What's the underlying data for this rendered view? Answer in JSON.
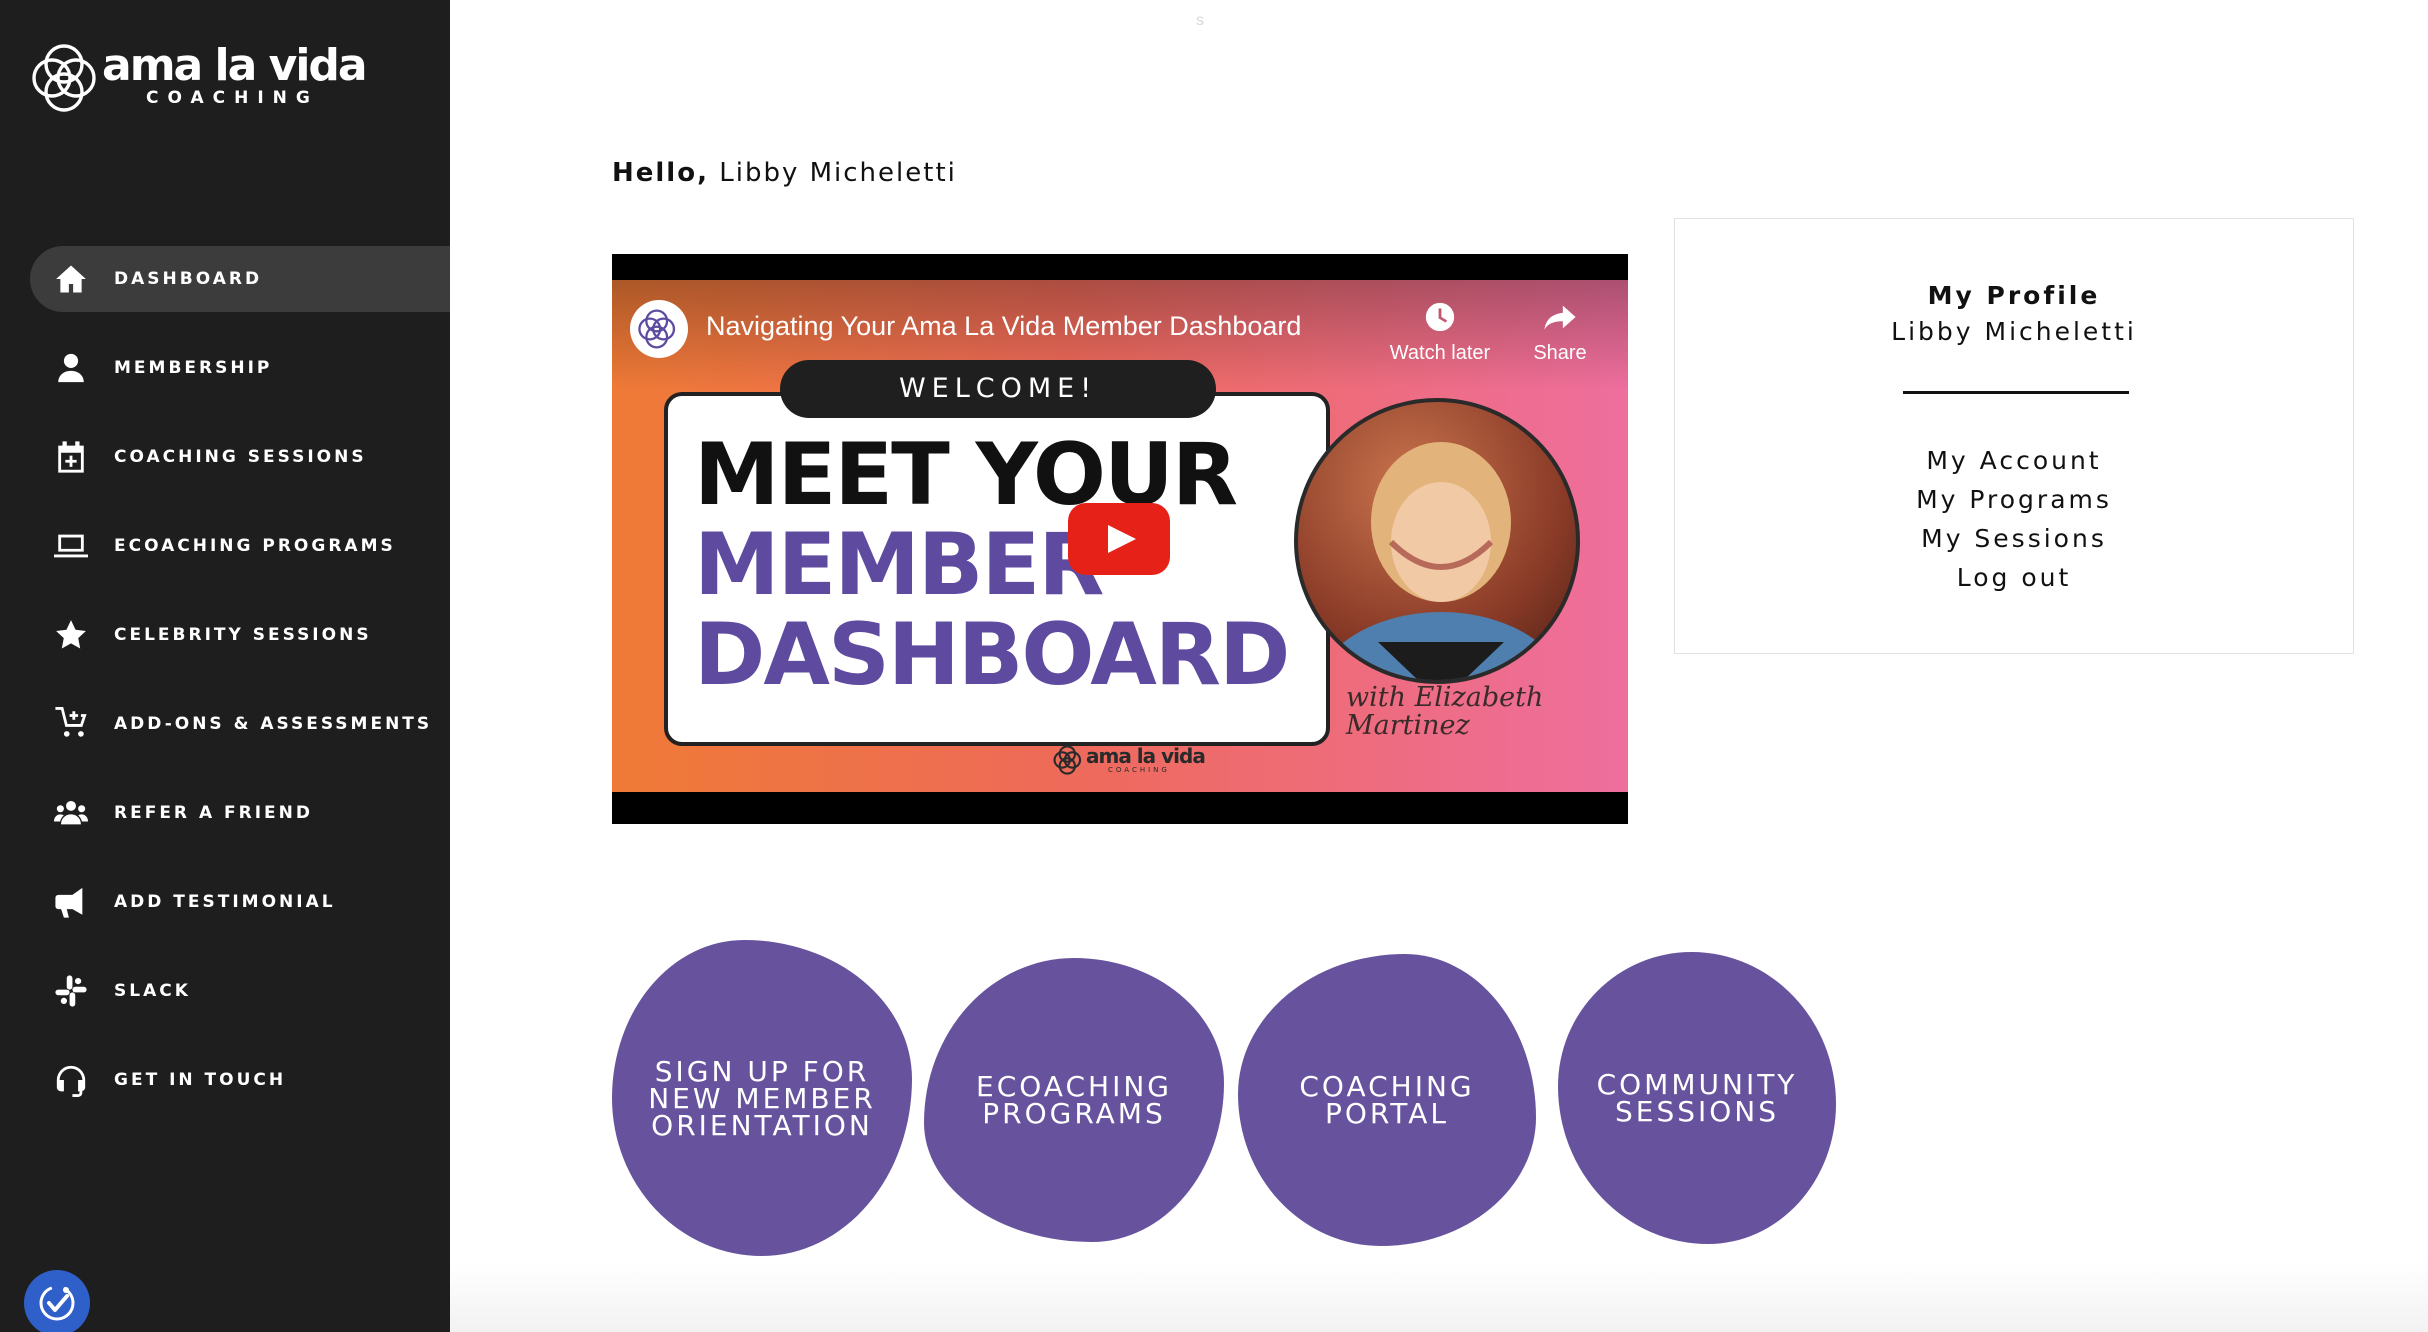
{
  "brand": {
    "name": "ama la vida",
    "tagline": "COACHING"
  },
  "sidebar": {
    "items": [
      {
        "label": "DASHBOARD",
        "icon": "home-icon",
        "active": true
      },
      {
        "label": "MEMBERSHIP",
        "icon": "user-icon",
        "active": false
      },
      {
        "label": "COACHING SESSIONS",
        "icon": "calendar-plus-icon",
        "active": false
      },
      {
        "label": "ECOACHING PROGRAMS",
        "icon": "laptop-icon",
        "active": false
      },
      {
        "label": "CELEBRITY SESSIONS",
        "icon": "star-icon",
        "active": false
      },
      {
        "label": "ADD-ONS & ASSESSMENTS",
        "icon": "cart-plus-icon",
        "active": false
      },
      {
        "label": "REFER A FRIEND",
        "icon": "users-icon",
        "active": false
      },
      {
        "label": "ADD TESTIMONIAL",
        "icon": "megaphone-icon",
        "active": false
      },
      {
        "label": "SLACK",
        "icon": "slack-icon",
        "active": false
      },
      {
        "label": "GET IN TOUCH",
        "icon": "headset-icon",
        "active": false
      }
    ],
    "accessibility_icon": "accessibility-icon"
  },
  "main": {
    "tiny_mark": "s",
    "greeting": {
      "prefix": "Hello,",
      "name": "Libby Micheletti"
    }
  },
  "video": {
    "title": "Navigating Your Ama La Vida Member Dashboard",
    "watch_later": "Watch later",
    "share": "Share",
    "welcome": "WELCOME!",
    "line1": "MEET YOUR",
    "line2": "MEMBER",
    "line3": "DASHBOARD",
    "credit_line1": "with Elizabeth",
    "credit_line2": "Martinez",
    "mini_brand": "ama la vida",
    "mini_tagline": "COACHING",
    "play_icon": "youtube-play-icon"
  },
  "profile": {
    "heading": "My Profile",
    "name": "Libby Micheletti",
    "links": [
      "My Account",
      "My Programs",
      "My Sessions",
      "Log out"
    ]
  },
  "blobs": [
    {
      "label": "SIGN UP FOR\nNEW MEMBER\nORIENTATION"
    },
    {
      "label": "ECOACHING\nPROGRAMS"
    },
    {
      "label": "COACHING\nPORTAL"
    },
    {
      "label": "COMMUNITY\nSESSIONS"
    }
  ],
  "colors": {
    "sidebar_bg": "#1e1e1e",
    "active_item_bg": "#3c3c3c",
    "brand_purple": "#66529d",
    "youtube_red": "#e62117",
    "accessibility_blue": "#2f5fc9"
  }
}
